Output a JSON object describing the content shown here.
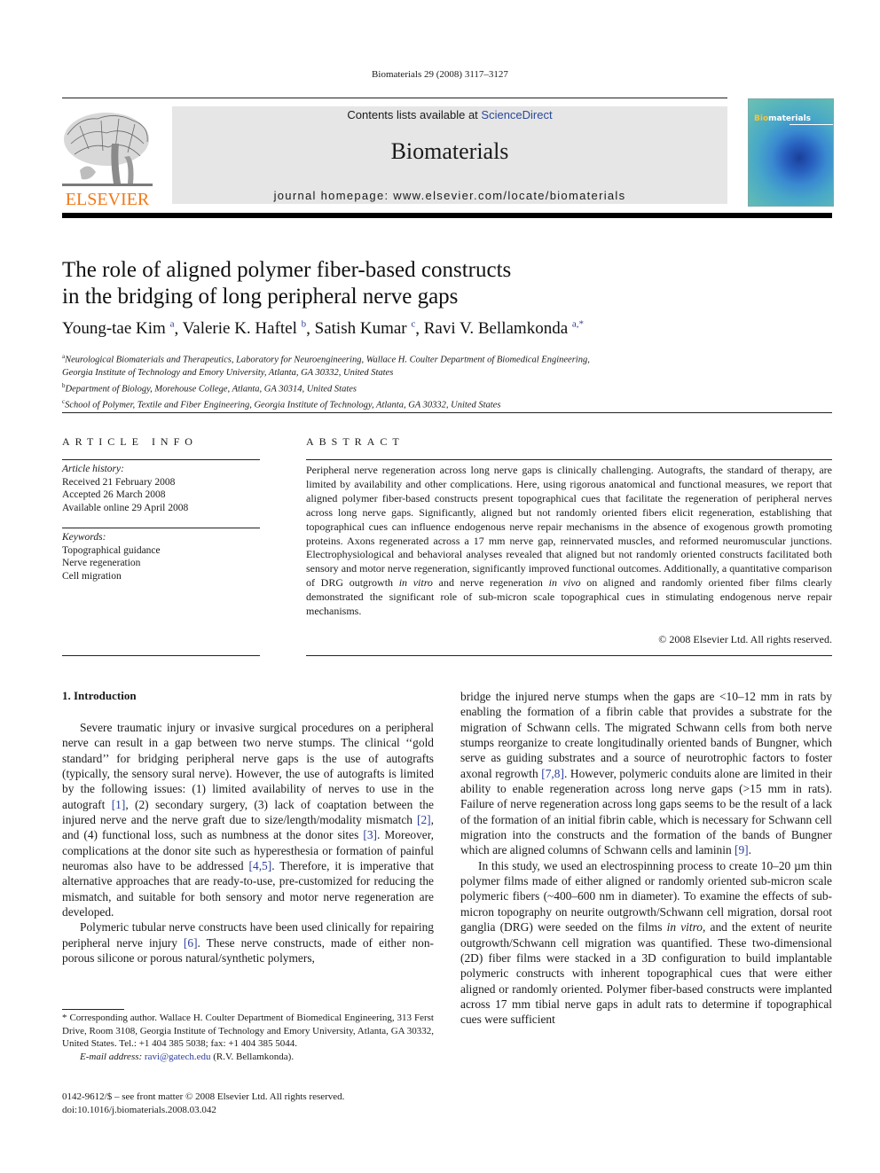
{
  "header": {
    "citation": "Biomaterials 29 (2008) 3117–3127",
    "contents_prefix": "Contents lists available at ",
    "contents_link": "ScienceDirect",
    "journal_name": "Biomaterials",
    "homepage": "journal homepage: www.elsevier.com/locate/biomaterials",
    "publisher_logo": "ELSEVIER",
    "cover": {
      "title_highlight": "Bio",
      "title_rest": "materials"
    },
    "colors": {
      "publisher_orange": "#f07a1a",
      "link_blue": "#2a3d9a"
    }
  },
  "article": {
    "title_line1": "The role of aligned polymer fiber-based constructs",
    "title_line2": "in the bridging of long peripheral nerve gaps",
    "authors": [
      {
        "name": "Young-tae Kim",
        "aff": "a",
        "sep": ", "
      },
      {
        "name": "Valerie K. Haftel",
        "aff": "b",
        "sep": ", "
      },
      {
        "name": "Satish Kumar",
        "aff": "c",
        "sep": ", "
      },
      {
        "name": "Ravi V. Bellamkonda",
        "aff": "a,*",
        "sep": ""
      }
    ],
    "affiliations": [
      {
        "mark": "a",
        "text": "Neurological Biomaterials and Therapeutics, Laboratory for Neuroengineering, Wallace H. Coulter Department of Biomedical Engineering,"
      },
      {
        "mark": "",
        "text": "Georgia Institute of Technology and Emory University, Atlanta, GA 30332, United States"
      },
      {
        "mark": "b",
        "text": "Department of Biology, Morehouse College, Atlanta, GA 30314, United States"
      },
      {
        "mark": "c",
        "text": "School of Polymer, Textile and Fiber Engineering, Georgia Institute of Technology, Atlanta, GA 30332, United States"
      }
    ]
  },
  "article_info": {
    "heading": "ARTICLE INFO",
    "history_label": "Article history:",
    "received": "Received 21 February 2008",
    "accepted": "Accepted 26 March 2008",
    "online": "Available online 29 April 2008",
    "keywords_label": "Keywords:",
    "keywords": [
      "Topographical guidance",
      "Nerve regeneration",
      "Cell migration"
    ]
  },
  "abstract": {
    "heading": "ABSTRACT",
    "part1": "Peripheral nerve regeneration across long nerve gaps is clinically challenging. Autografts, the standard of therapy, are limited by availability and other complications. Here, using rigorous anatomical and functional measures, we report that aligned polymer fiber-based constructs present topographical cues that facilitate the regeneration of peripheral nerves across long nerve gaps. Significantly, aligned but not randomly oriented fibers elicit regeneration, establishing that topographical cues can influence endogenous nerve repair mechanisms in the absence of exogenous growth promoting proteins. Axons regenerated across a 17 mm nerve gap, reinnervated muscles, and reformed neuromuscular junctions. Electrophysiological and behavioral analyses revealed that aligned but not randomly oriented constructs facilitated both sensory and motor nerve regeneration, significantly improved functional outcomes. Additionally, a quantitative comparison of DRG outgrowth ",
    "italic1": "in vitro",
    "part2": " and nerve regeneration ",
    "italic2": "in vivo",
    "part3": " on aligned and randomly oriented fiber films clearly demonstrated the significant role of sub-micron scale topographical cues in stimulating endogenous nerve repair mechanisms.",
    "copyright": "© 2008 Elsevier Ltd. All rights reserved."
  },
  "introduction": {
    "heading": "1.  Introduction",
    "p1": {
      "t1": "Severe traumatic injury or invasive surgical procedures on a peripheral nerve can result in a gap between two nerve stumps. The clinical ‘‘gold standard’’ for bridging peripheral nerve gaps is the use of autografts (typically, the sensory sural nerve). However, the use of autografts is limited by the following issues: (1) limited availability of nerves to use in the autograft ",
      "r1": "[1]",
      "t2": ", (2) secondary surgery, (3) lack of coaptation between the injured nerve and the nerve graft due to size/length/modality mismatch ",
      "r2": "[2]",
      "t3": ", and (4) functional loss, such as numbness at the donor sites ",
      "r3": "[3]",
      "t4": ". Moreover, complications at the donor site such as hyperesthesia or formation of painful neuromas also have to be addressed ",
      "r4": "[4,5]",
      "t5": ". Therefore, it is imperative that alternative approaches that are ready-to-use, pre-customized for reducing the mismatch, and suitable for both sensory and motor nerve regeneration are developed."
    },
    "p2": {
      "t1": "Polymeric tubular nerve constructs have been used clinically for repairing peripheral nerve injury ",
      "r1": "[6]",
      "t2": ". These nerve constructs, made of either non-porous silicone or porous natural/synthetic polymers, bridge the injured nerve stumps when the gaps are <10–12 mm in rats by enabling the formation of a fibrin cable that provides a substrate for the migration of Schwann cells. The migrated Schwann cells from both nerve stumps reorganize to create longitudinally oriented bands of Bungner, which serve as guiding substrates and a source of neurotrophic factors to foster axonal regrowth ",
      "r2": "[7,8]",
      "t3": ". However, polymeric conduits alone are limited in their ability to enable regeneration across long nerve gaps (>15 mm in rats). Failure of nerve regeneration across long gaps seems to be the result of a lack of the formation of an initial fibrin cable, which is necessary for Schwann cell migration into the constructs and the formation of the bands of Bungner which are aligned columns of Schwann cells and laminin ",
      "r3": "[9]",
      "t4": "."
    },
    "p2_left": "Polymeric tubular nerve constructs have been used clinically for repairing peripheral nerve injury ",
    "p2_left_ref": "[6]",
    "p2_left_tail": ". These nerve constructs, made of either non-porous silicone or porous natural/synthetic polymers,",
    "p2_right_start": "bridge the injured nerve stumps when the gaps are <10–12 mm in rats by enabling the formation of a fibrin cable that provides a substrate for the migration of Schwann cells. The migrated Schwann cells from both nerve stumps reorganize to create longitudinally oriented bands of Bungner, which serve as guiding substrates and a source of neurotrophic factors to foster axonal regrowth ",
    "p2_right_ref1": "[7,8]",
    "p2_right_mid": ". However, polymeric conduits alone are limited in their ability to enable regeneration across long nerve gaps (>15 mm in rats). Failure of nerve regeneration across long gaps seems to be the result of a lack of the formation of an initial fibrin cable, which is necessary for Schwann cell migration into the constructs and the formation of the bands of Bungner which are aligned columns of Schwann cells and laminin ",
    "p2_right_ref2": "[9]",
    "p2_right_end": ".",
    "p3": {
      "t1": "In this study, we used an electrospinning process to create 10–20 µm thin polymer films made of either aligned or randomly oriented sub-micron scale polymeric fibers (~400–600 nm in diameter). To examine the effects of sub-micron topography on neurite outgrowth/Schwann cell migration, dorsal root ganglia (DRG) were seeded on the films ",
      "i1": "in vitro",
      "t2": ", and the extent of neurite outgrowth/Schwann cell migration was quantified. These two-dimensional (2D) fiber films were stacked in a 3D configuration to build implantable polymeric constructs with inherent topographical cues that were either aligned or randomly oriented. Polymer fiber-based constructs were implanted across 17 mm tibial nerve gaps in adult rats to determine if topographical cues were sufficient"
    }
  },
  "footnote": {
    "corresponding": "* Corresponding author. Wallace H. Coulter Department of Biomedical Engineering, 313 Ferst Drive, Room 3108, Georgia Institute of Technology and Emory University, Atlanta, GA 30332, United States. Tel.: +1 404 385 5038; fax: +1 404 385 5044.",
    "email_label": "E-mail address:",
    "email": "ravi@gatech.edu",
    "email_owner": " (R.V. Bellamkonda).",
    "front_matter": "0142-9612/$ – see front matter © 2008 Elsevier Ltd. All rights reserved.",
    "doi": "doi:10.1016/j.biomaterials.2008.03.042"
  }
}
